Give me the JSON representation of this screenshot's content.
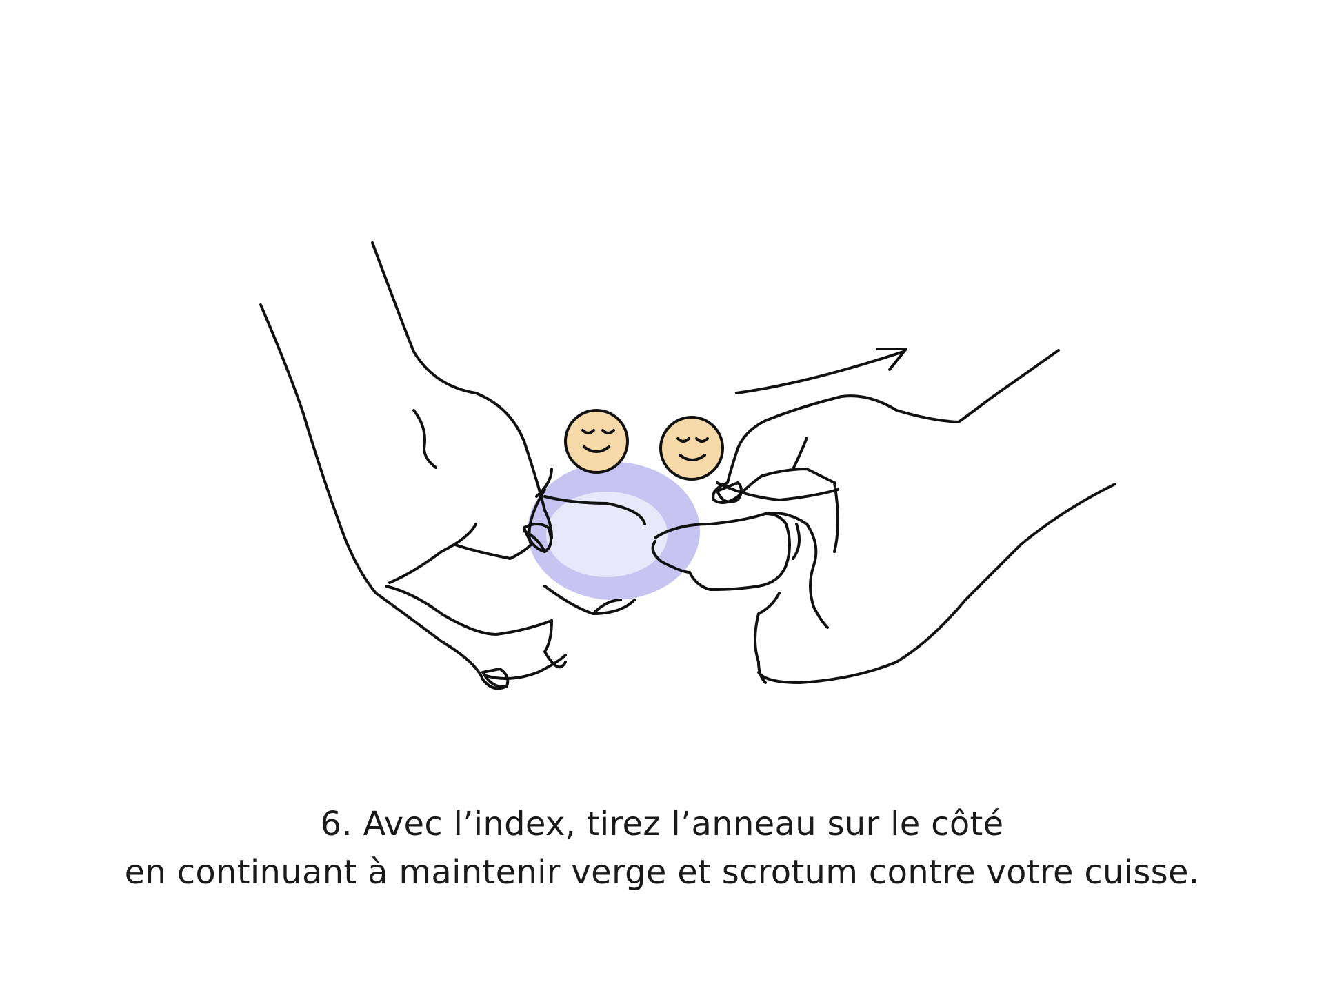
{
  "colors": {
    "background": "#ffffff",
    "ink": "#111111",
    "ring": "#c8c4f2",
    "ring_inner": "#e9e8fb",
    "face": "#f6d9a8"
  },
  "caption": {
    "line1": "6. Avec l’index, tirez l’anneau sur le côté",
    "line2": "en continuant à maintenir verge et scrotum contre votre cuisse."
  }
}
